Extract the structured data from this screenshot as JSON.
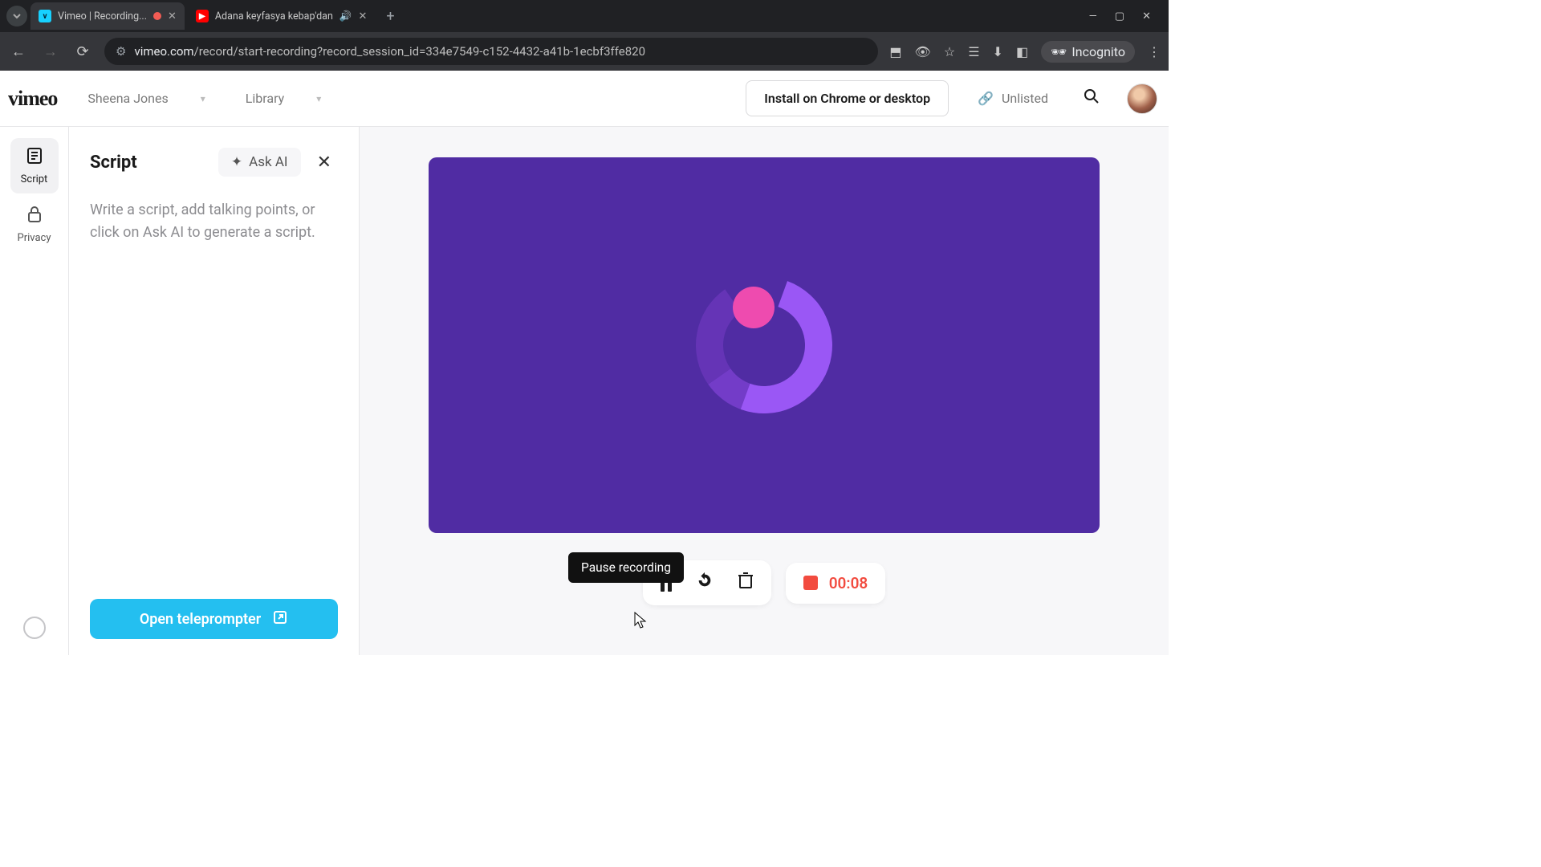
{
  "browser": {
    "tabs": [
      {
        "favicon": "V",
        "title": "Vimeo | Recording...",
        "recording": true
      },
      {
        "favicon": "Y",
        "title": "Adana keyfasya kebap'dan",
        "audio": true
      }
    ],
    "url_host": "vimeo.com",
    "url_path": "/record/start-recording?record_session_id=334e7549-c152-4432-a41b-1ecbf3ffe820",
    "incognito_label": "Incognito"
  },
  "header": {
    "logo": "vimeo",
    "user_dropdown": "Sheena Jones",
    "folder_dropdown": "Library",
    "install_label": "Install on Chrome or desktop",
    "visibility_label": "Unlisted"
  },
  "rail": {
    "items": [
      {
        "icon": "script",
        "label": "Script",
        "active": true
      },
      {
        "icon": "lock",
        "label": "Privacy",
        "active": false
      }
    ]
  },
  "panel": {
    "title": "Script",
    "ask_ai_label": "Ask AI",
    "placeholder": "Write a script, add talking points, or click on Ask AI to generate a script.",
    "teleprompter_label": "Open teleprompter"
  },
  "stage": {
    "tooltip": "Pause recording",
    "timer": "00:08"
  }
}
